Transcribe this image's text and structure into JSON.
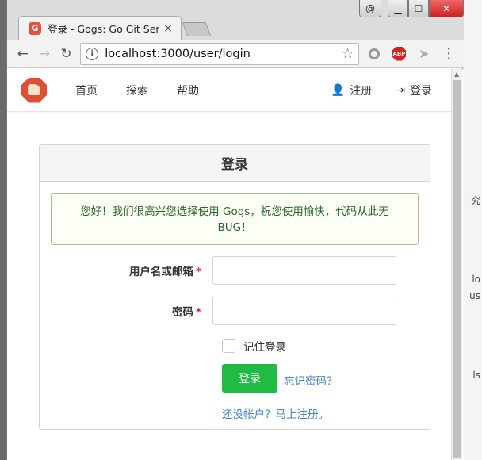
{
  "browser": {
    "tab_title": "登录 - Gogs: Go Git Ser",
    "favicon_letter": "G",
    "tab_close": "×",
    "url": "localhost:3000/user/login",
    "window_controls": {
      "user": "@",
      "minimize": "▁",
      "maximize": "☐",
      "close": "✕"
    },
    "extension_abp": "ABP"
  },
  "nav": {
    "links": [
      "首页",
      "探索",
      "帮助"
    ],
    "register": "注册",
    "login": "登录"
  },
  "login": {
    "title": "登录",
    "flash": "您好！我们很高兴您选择使用 Gogs，祝您使用愉快，代码从此无 BUG！",
    "username_label": "用户名或邮箱",
    "password_label": "密码",
    "required_mark": "*",
    "remember_label": "记住登录",
    "submit": "登录",
    "forgot": "忘记密码？",
    "signup": "还没帐户？马上注册。"
  },
  "desktop_fragments": [
    "究",
    "lo",
    "us",
    "ls"
  ],
  "colors": {
    "primary_button": "#21ba45",
    "link": "#4183c4",
    "flash_text": "#2c662d",
    "flash_border": "#a3c293",
    "required": "#db2828",
    "logo": "#e24d35"
  }
}
